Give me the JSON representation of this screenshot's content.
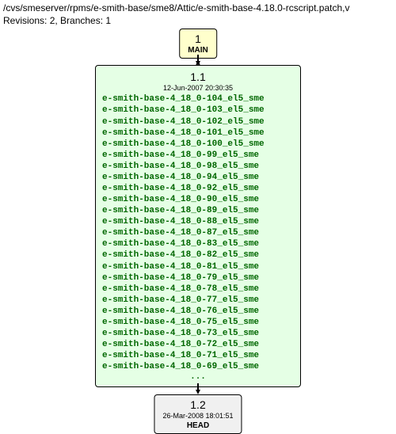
{
  "header": {
    "path": "/cvs/smeserver/rpms/e-smith-base/sme8/Attic/e-smith-base-4.18.0-rcscript.patch,v",
    "revisions_line": "Revisions: 2, Branches: 1"
  },
  "branch_node": {
    "number": "1",
    "name": "MAIN"
  },
  "main_node": {
    "rev": "1.1",
    "timestamp": "12-Jun-2007 20:30:35",
    "tags": [
      "e-smith-base-4_18_0-104_el5_sme",
      "e-smith-base-4_18_0-103_el5_sme",
      "e-smith-base-4_18_0-102_el5_sme",
      "e-smith-base-4_18_0-101_el5_sme",
      "e-smith-base-4_18_0-100_el5_sme",
      "e-smith-base-4_18_0-99_el5_sme",
      "e-smith-base-4_18_0-98_el5_sme",
      "e-smith-base-4_18_0-94_el5_sme",
      "e-smith-base-4_18_0-92_el5_sme",
      "e-smith-base-4_18_0-90_el5_sme",
      "e-smith-base-4_18_0-89_el5_sme",
      "e-smith-base-4_18_0-88_el5_sme",
      "e-smith-base-4_18_0-87_el5_sme",
      "e-smith-base-4_18_0-83_el5_sme",
      "e-smith-base-4_18_0-82_el5_sme",
      "e-smith-base-4_18_0-81_el5_sme",
      "e-smith-base-4_18_0-79_el5_sme",
      "e-smith-base-4_18_0-78_el5_sme",
      "e-smith-base-4_18_0-77_el5_sme",
      "e-smith-base-4_18_0-76_el5_sme",
      "e-smith-base-4_18_0-75_el5_sme",
      "e-smith-base-4_18_0-73_el5_sme",
      "e-smith-base-4_18_0-72_el5_sme",
      "e-smith-base-4_18_0-71_el5_sme",
      "e-smith-base-4_18_0-69_el5_sme"
    ],
    "more": "..."
  },
  "head_node": {
    "rev": "1.2",
    "timestamp": "26-Mar-2008 18:01:51",
    "branch": "HEAD"
  }
}
